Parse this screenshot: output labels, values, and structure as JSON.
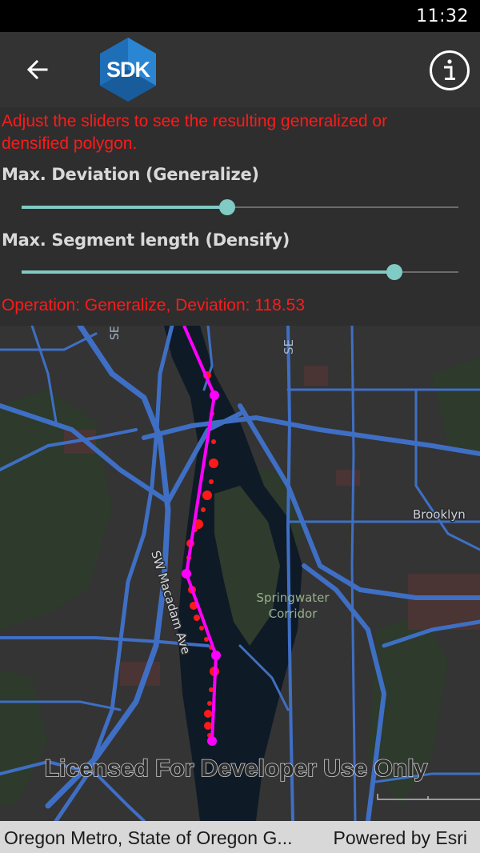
{
  "status_bar": {
    "time": "11:32"
  },
  "app_bar": {
    "back_icon": "arrow-left-icon",
    "logo_text": "SDK",
    "info_icon": "info-icon"
  },
  "controls": {
    "instructions": "Adjust the sliders to see the resulting generalized or densified polygon.",
    "deviation_label": "Max. Deviation (Generalize)",
    "deviation_value_fraction": 0.47,
    "segment_label": "Max. Segment length (Densify)",
    "segment_value_fraction": 0.854,
    "operation_text": "Operation: Generalize, Deviation: 118.53"
  },
  "map": {
    "labels": {
      "street_top_left": "SE",
      "street_top_mid": "SE",
      "brooklyn": "Brooklyn",
      "springwater_line1": "Springwater",
      "springwater_line2": "Corridor",
      "macadam": "SW Macadam Ave"
    },
    "watermark": "Licensed For Developer Use Only",
    "colors": {
      "roads": "#3f6fc4",
      "water": "#0f1a27",
      "generalized_line": "#ff00ff",
      "densified_points": "#ff1a1a"
    }
  },
  "attribution": {
    "left": "Oregon Metro, State of Oregon G...",
    "right": "Powered by Esri"
  }
}
